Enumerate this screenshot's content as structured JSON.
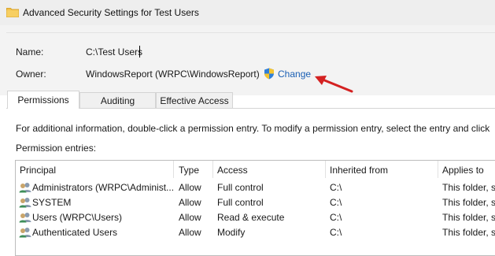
{
  "window": {
    "title": "Advanced Security Settings for Test Users"
  },
  "fields": {
    "name_label": "Name:",
    "name_value": "C:\\Test Users",
    "owner_label": "Owner:",
    "owner_value": "WindowsReport (WRPC\\WindowsReport)",
    "change_label": "Change"
  },
  "tabs": [
    {
      "label": "Permissions",
      "active": true
    },
    {
      "label": "Auditing",
      "active": false
    },
    {
      "label": "Effective Access",
      "active": false
    }
  ],
  "info_text": "For additional information, double-click a permission entry. To modify a permission entry, select the entry and click",
  "entries_label": "Permission entries:",
  "table": {
    "headers": [
      "Principal",
      "Type",
      "Access",
      "Inherited from",
      "Applies to"
    ],
    "rows": [
      {
        "principal": "Administrators (WRPC\\Administ...",
        "type": "Allow",
        "access": "Full control",
        "inherited": "C:\\",
        "applies": "This folder, s"
      },
      {
        "principal": "SYSTEM",
        "type": "Allow",
        "access": "Full control",
        "inherited": "C:\\",
        "applies": "This folder, s"
      },
      {
        "principal": "Users (WRPC\\Users)",
        "type": "Allow",
        "access": "Read & execute",
        "inherited": "C:\\",
        "applies": "This folder, s"
      },
      {
        "principal": "Authenticated Users",
        "type": "Allow",
        "access": "Modify",
        "inherited": "C:\\",
        "applies": "This folder, s"
      }
    ]
  },
  "icons": {
    "folder": "folder-icon",
    "shield": "uac-shield-icon",
    "user": "user-group-icon",
    "arrow": "red-arrow"
  },
  "colors": {
    "link": "#1a5fb4",
    "arrow": "#d42121",
    "folder": "#f2c14e"
  }
}
